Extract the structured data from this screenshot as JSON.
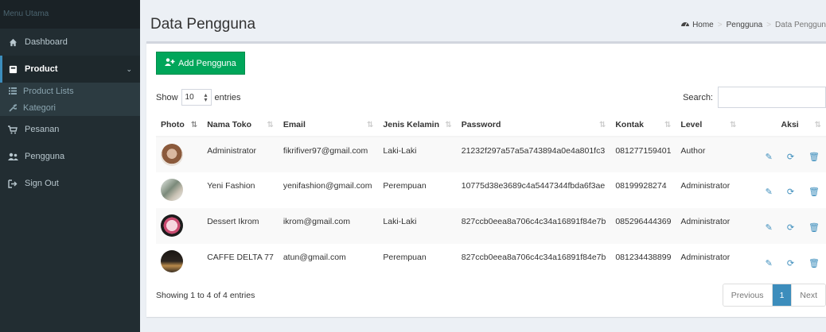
{
  "sidebar": {
    "header": "Menu Utama",
    "items": [
      {
        "label": "Dashboard",
        "icon": "home-icon"
      },
      {
        "label": "Product",
        "icon": "product-icon"
      },
      {
        "label": "Pesanan",
        "icon": "cart-icon"
      },
      {
        "label": "Pengguna",
        "icon": "users-icon"
      },
      {
        "label": "Sign Out",
        "icon": "sign-out-icon"
      }
    ],
    "submenu": [
      {
        "label": "Product Lists",
        "icon": "list-icon"
      },
      {
        "label": "Kategori",
        "icon": "wrench-icon"
      }
    ]
  },
  "header": {
    "title": "Data Pengguna",
    "breadcrumb": [
      "Home",
      "Pengguna",
      "Data Penggun"
    ]
  },
  "toolbar": {
    "add_label": "Add Pengguna"
  },
  "datatable": {
    "show_label": "Show",
    "entries_value": "10",
    "entries_label": "entries",
    "search_label": "Search:",
    "search_value": ""
  },
  "table": {
    "columns": [
      "Photo",
      "Nama Toko",
      "Email",
      "Jenis Kelamin",
      "Password",
      "Kontak",
      "Level",
      "Aksi"
    ],
    "rows": [
      {
        "nama": "Administrator",
        "email": "fikrifiver97@gmail.com",
        "jk": "Laki-Laki",
        "password": "21232f297a57a5a743894a0e4a801fc3",
        "kontak": "081277159401",
        "level": "Author",
        "photo_color": "#8b5a3c"
      },
      {
        "nama": "Yeni Fashion",
        "email": "yenifashion@gmail.com",
        "jk": "Perempuan",
        "password": "10775d38e3689c4a5447344fbda6f3ae",
        "kontak": "08199928274",
        "level": "Administrator",
        "photo_color": "#7b8a7a"
      },
      {
        "nama": "Dessert Ikrom",
        "email": "ikrom@gmail.com",
        "jk": "Laki-Laki",
        "password": "827ccb0eea8a706c4c34a16891f84e7b",
        "kontak": "085296444369",
        "level": "Administrator",
        "photo_color": "#c94b70"
      },
      {
        "nama": "CAFFE DELTA 77",
        "email": "atun@gmail.com",
        "jk": "Perempuan",
        "password": "827ccb0eea8a706c4c34a16891f84e7b",
        "kontak": "081234438899",
        "level": "Administrator",
        "photo_color": "#2d2620"
      }
    ]
  },
  "footer": {
    "info": "Showing 1 to 4 of 4 entries",
    "prev": "Previous",
    "page": "1",
    "next": "Next"
  },
  "colors": {
    "sidebar_bg": "#222d32",
    "primary": "#3c8dbc",
    "success": "#00a65a"
  }
}
